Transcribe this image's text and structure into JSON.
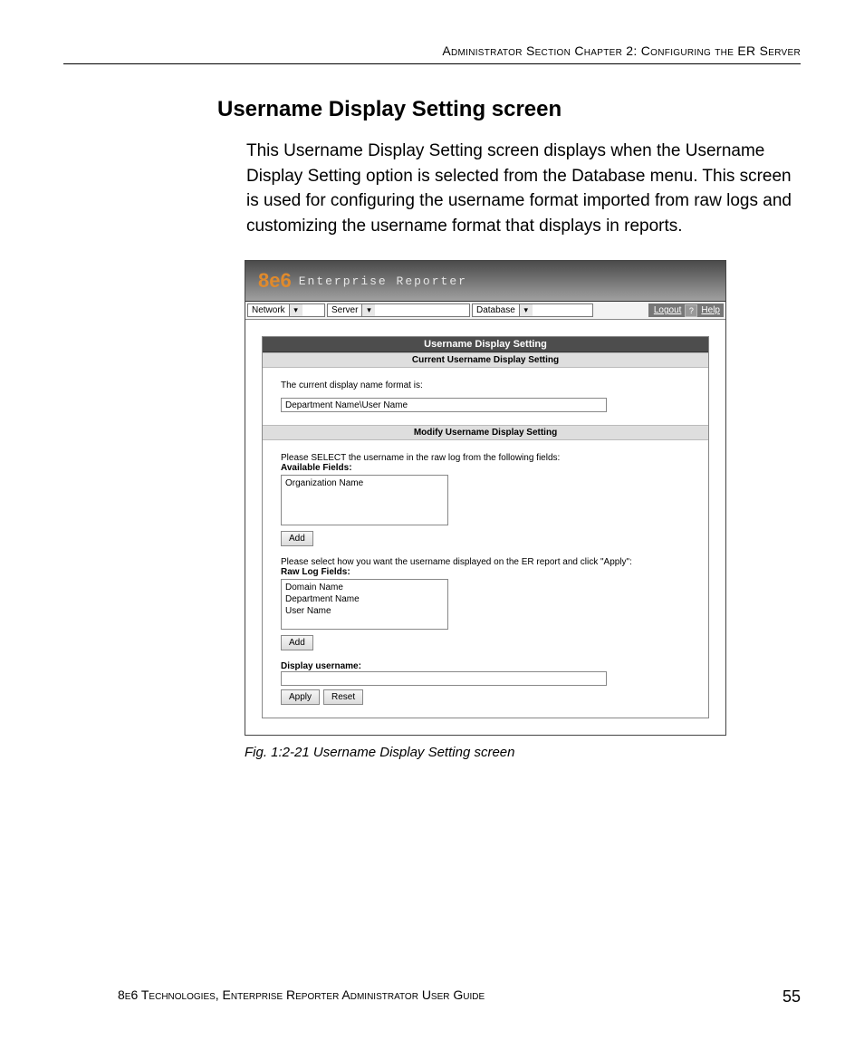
{
  "header": {
    "running_head": "Administrator Section   Chapter 2: Configuring the ER Server"
  },
  "section": {
    "title": "Username Display Setting screen",
    "intro": "This Username Display Setting screen displays when the Username Display Setting option is selected from the Database menu. This screen is used for configuring the username format imported from raw logs and customizing the username format that displays in reports."
  },
  "app": {
    "brand": "8e6",
    "brand_sub": "Enterprise Reporter",
    "menus": {
      "network": "Network",
      "server": "Server",
      "database": "Database"
    },
    "links": {
      "logout": "Logout",
      "help": "Help",
      "help_icon": "?"
    },
    "panel_title": "Username Display Setting",
    "current": {
      "section_title": "Current Username Display Setting",
      "label": "The current display name format is:",
      "value": "Department Name\\User Name"
    },
    "modify": {
      "section_title": "Modify Username Display Setting",
      "instruction1": "Please SELECT the username in the raw log from the following fields:",
      "available_label": "Available Fields:",
      "available_items": [
        "Organization Name"
      ],
      "add1": "Add",
      "instruction2": "Please select how you want the username displayed on the ER report and click \"Apply\":",
      "rawlog_label": "Raw Log Fields:",
      "rawlog_items": [
        "Domain Name",
        "Department Name",
        "User Name"
      ],
      "add2": "Add",
      "display_label": "Display username:",
      "display_value": "",
      "apply": "Apply",
      "reset": "Reset"
    }
  },
  "caption": "Fig. 1:2-21  Username Display Setting screen",
  "footer": {
    "left": "8e6 Technologies, Enterprise Reporter Administrator User Guide",
    "right": "55"
  }
}
